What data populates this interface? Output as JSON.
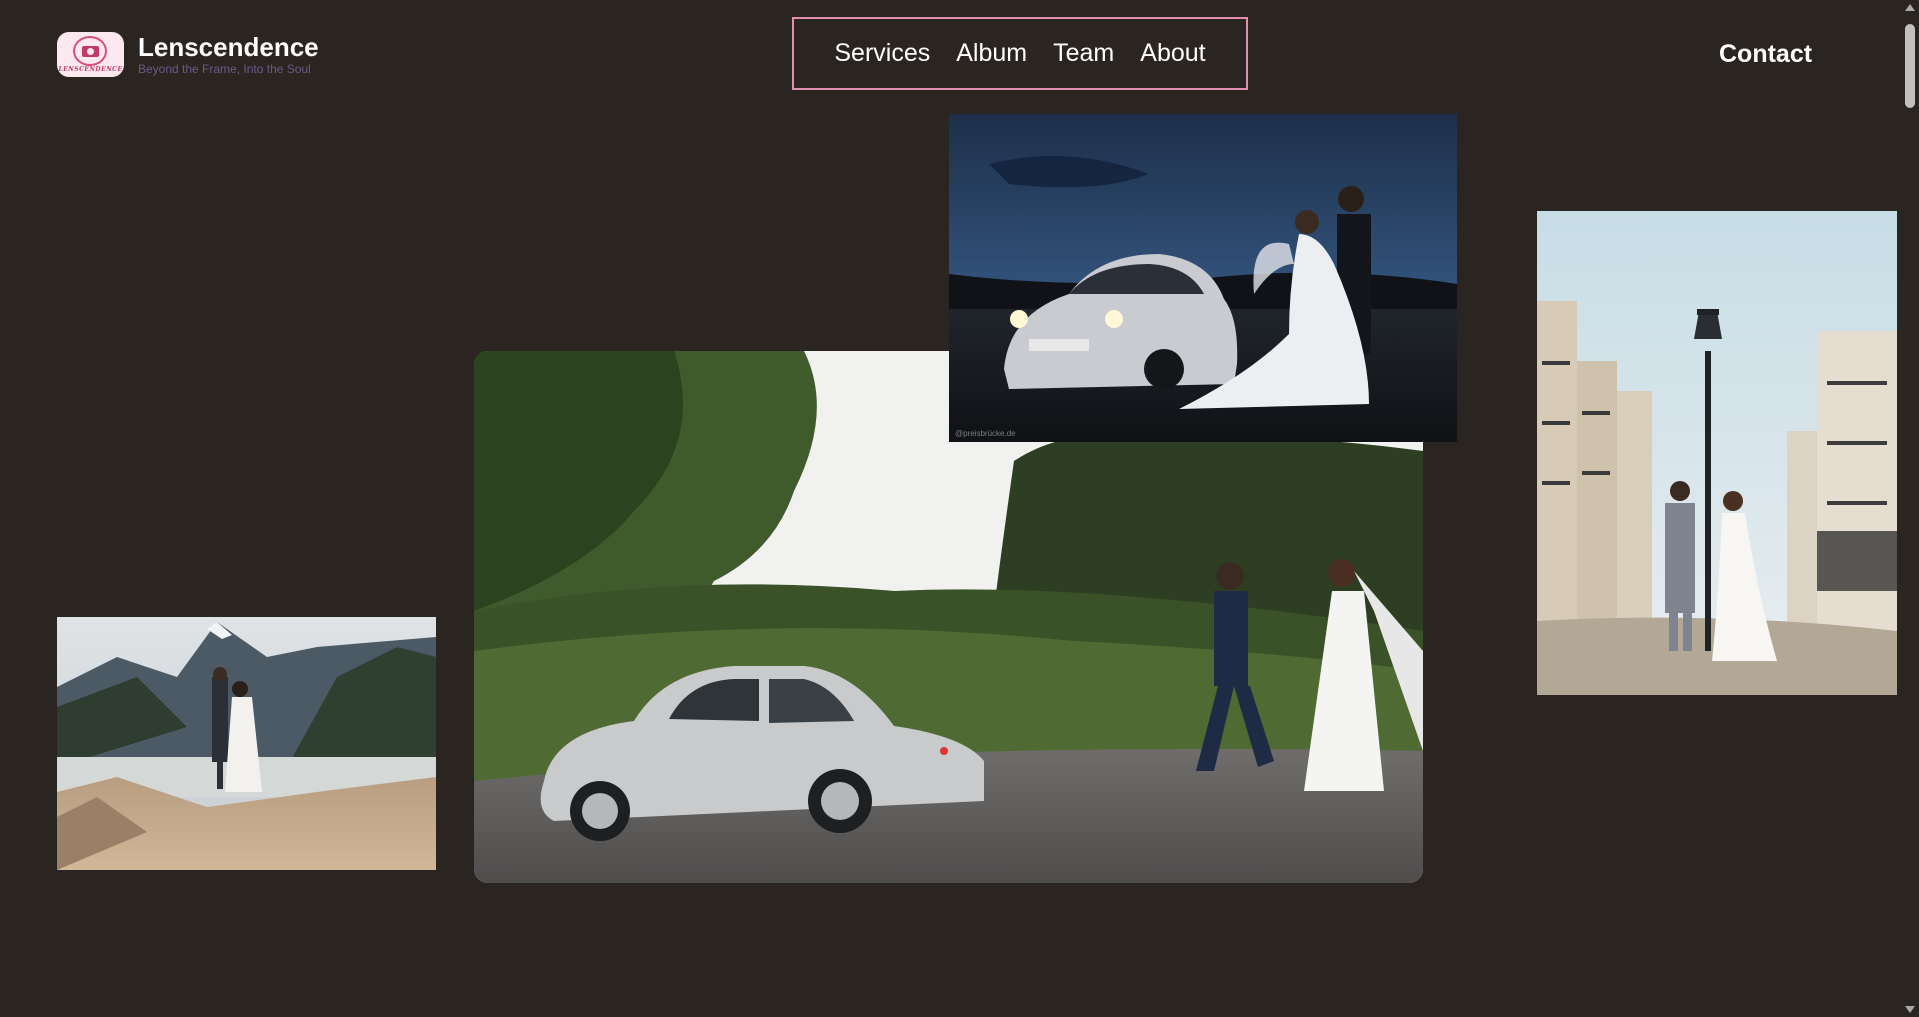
{
  "brand": {
    "name": "Lenscendence",
    "tagline": "Beyond the Frame, Into the Soul",
    "logo_text": "LENSCENDENCE",
    "logo_icon": "camera-badge-icon"
  },
  "nav": {
    "items": [
      {
        "label": "Services"
      },
      {
        "label": "Album"
      },
      {
        "label": "Team"
      },
      {
        "label": "About"
      }
    ],
    "border_color": "#e48fb2"
  },
  "contact": {
    "label": "Contact"
  },
  "gallery": {
    "photos": [
      {
        "name": "mountain-lake-couple",
        "alt": "Couple embracing on a cliff above a mountain lake"
      },
      {
        "name": "vintage-car-road-couple",
        "alt": "Couple walking hand in hand beside a vintage white car"
      },
      {
        "name": "night-fiat-couple",
        "alt": "Couple at dusk next to a small white car with headlights on"
      },
      {
        "name": "paris-lamp-couple",
        "alt": "Couple by a lamp post on Parisian steps"
      }
    ],
    "watermark": "@preisbrücke.de"
  },
  "colors": {
    "background": "#2b2522",
    "text": "#ffffff",
    "tagline": "#6a5a86",
    "accent": "#e48fb2"
  }
}
